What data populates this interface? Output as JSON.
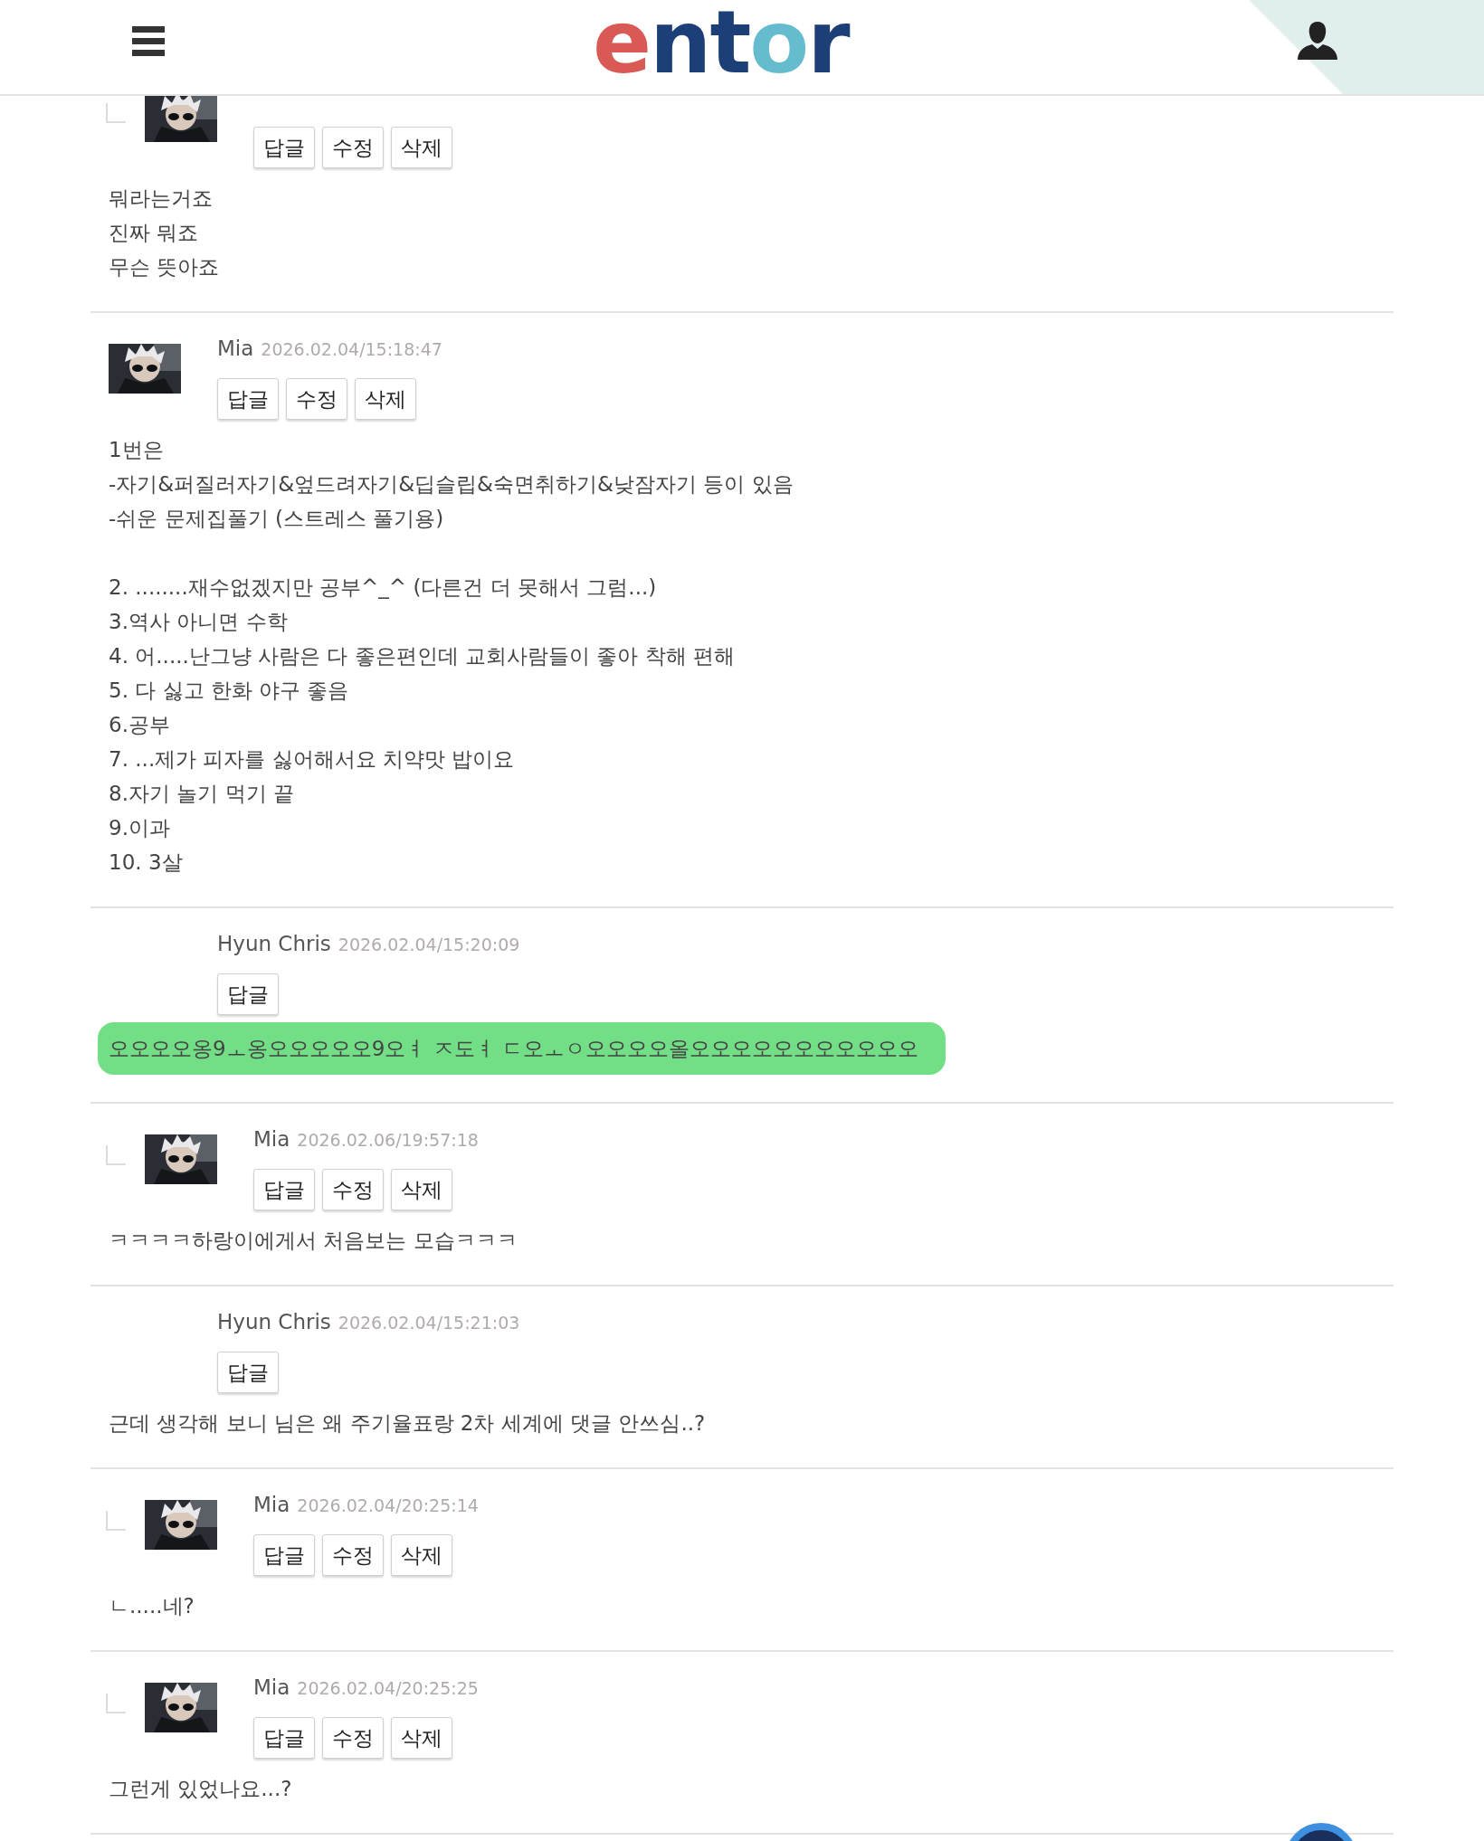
{
  "header": {
    "logo": "entor"
  },
  "comments": [
    {
      "kind": "reply",
      "has_avatar": true,
      "highlighted": false,
      "buttons": [
        "답글",
        "수정",
        "삭제"
      ],
      "paragraphs": [
        [
          "뭐라는거죠",
          "진짜 뭐죠",
          "무슨 뜻아죠"
        ]
      ]
    },
    {
      "kind": "top",
      "author": "Mia",
      "date": "2026.02.04/15:18:47",
      "has_avatar": true,
      "highlighted": false,
      "buttons": [
        "답글",
        "수정",
        "삭제"
      ],
      "paragraphs": [
        [
          "1번은",
          "-자기&퍼질러자기&엎드려자기&딥슬립&숙면취하기&낮잠자기 등이 있음",
          "-쉬운 문제집풀기 (스트레스 풀기용)"
        ],
        [
          "2. ........재수없겠지만 공부^_^ (다른건 더 못해서 그럼...)",
          "3.역사 아니면 수학",
          "4. 어.....난그냥 사람은 다 좋은편인데 교회사람들이 좋아 착해 편해",
          "5. 다 싫고 한화 야구 좋음",
          "6.공부",
          "7. ...제가 피자를 싫어해서요 치약맛 밥이요",
          "8.자기 놀기 먹기 끝",
          "9.이과",
          "10. 3살"
        ]
      ]
    },
    {
      "kind": "top",
      "author": "Hyun Chris",
      "date": "2026.02.04/15:20:09",
      "has_avatar": false,
      "highlighted": true,
      "buttons": [
        "답글"
      ],
      "paragraphs": [
        [
          "오오오오옹9ㅗ옹오오오오오9오ㅕ ㅈ도ㅕ ㄷ오ㅗㅇ오오오오올오오오오오오오오오오오"
        ]
      ]
    },
    {
      "kind": "reply",
      "author": "Mia",
      "date": "2026.02.06/19:57:18",
      "has_avatar": true,
      "highlighted": false,
      "buttons": [
        "답글",
        "수정",
        "삭제"
      ],
      "paragraphs": [
        [
          "ㅋㅋㅋㅋ하랑이에게서 처음보는 모습ㅋㅋㅋ"
        ]
      ]
    },
    {
      "kind": "top",
      "author": "Hyun Chris",
      "date": "2026.02.04/15:21:03",
      "has_avatar": false,
      "highlighted": false,
      "buttons": [
        "답글"
      ],
      "paragraphs": [
        [
          "근데 생각해 보니 님은 왜 주기율표랑 2차 세계에 댓글 안쓰심..?"
        ]
      ]
    },
    {
      "kind": "reply",
      "author": "Mia",
      "date": "2026.02.04/20:25:14",
      "has_avatar": true,
      "highlighted": false,
      "buttons": [
        "답글",
        "수정",
        "삭제"
      ],
      "paragraphs": [
        [
          "ㄴ.....네?"
        ]
      ]
    },
    {
      "kind": "reply",
      "author": "Mia",
      "date": "2026.02.04/20:25:25",
      "has_avatar": true,
      "highlighted": false,
      "buttons": [
        "답글",
        "수정",
        "삭제"
      ],
      "paragraphs": [
        [
          "그런게 있었나요...?"
        ]
      ]
    }
  ]
}
